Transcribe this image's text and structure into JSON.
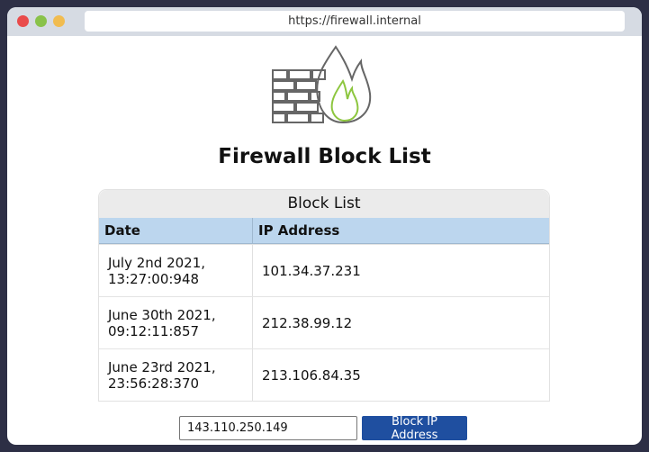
{
  "browser": {
    "url": "https://firewall.internal"
  },
  "page": {
    "title": "Firewall Block List"
  },
  "block_table": {
    "caption": "Block List",
    "columns": [
      "Date",
      "IP Address"
    ],
    "rows": [
      {
        "date": "July 2nd 2021, 13:27:00:948",
        "ip": "101.34.37.231"
      },
      {
        "date": "June 30th 2021, 09:12:11:857",
        "ip": "212.38.99.12"
      },
      {
        "date": "June 23rd 2021, 23:56:28:370",
        "ip": "213.106.84.35"
      }
    ]
  },
  "form": {
    "ip_input_value": "143.110.250.149",
    "submit_label": "Block IP Address"
  },
  "colors": {
    "accent_button": "#1f4fa0",
    "header_row": "#bcd6ee",
    "logo_flame_inner": "#8dc63f"
  },
  "icons": {
    "logo": "firewall-flame-icon"
  }
}
